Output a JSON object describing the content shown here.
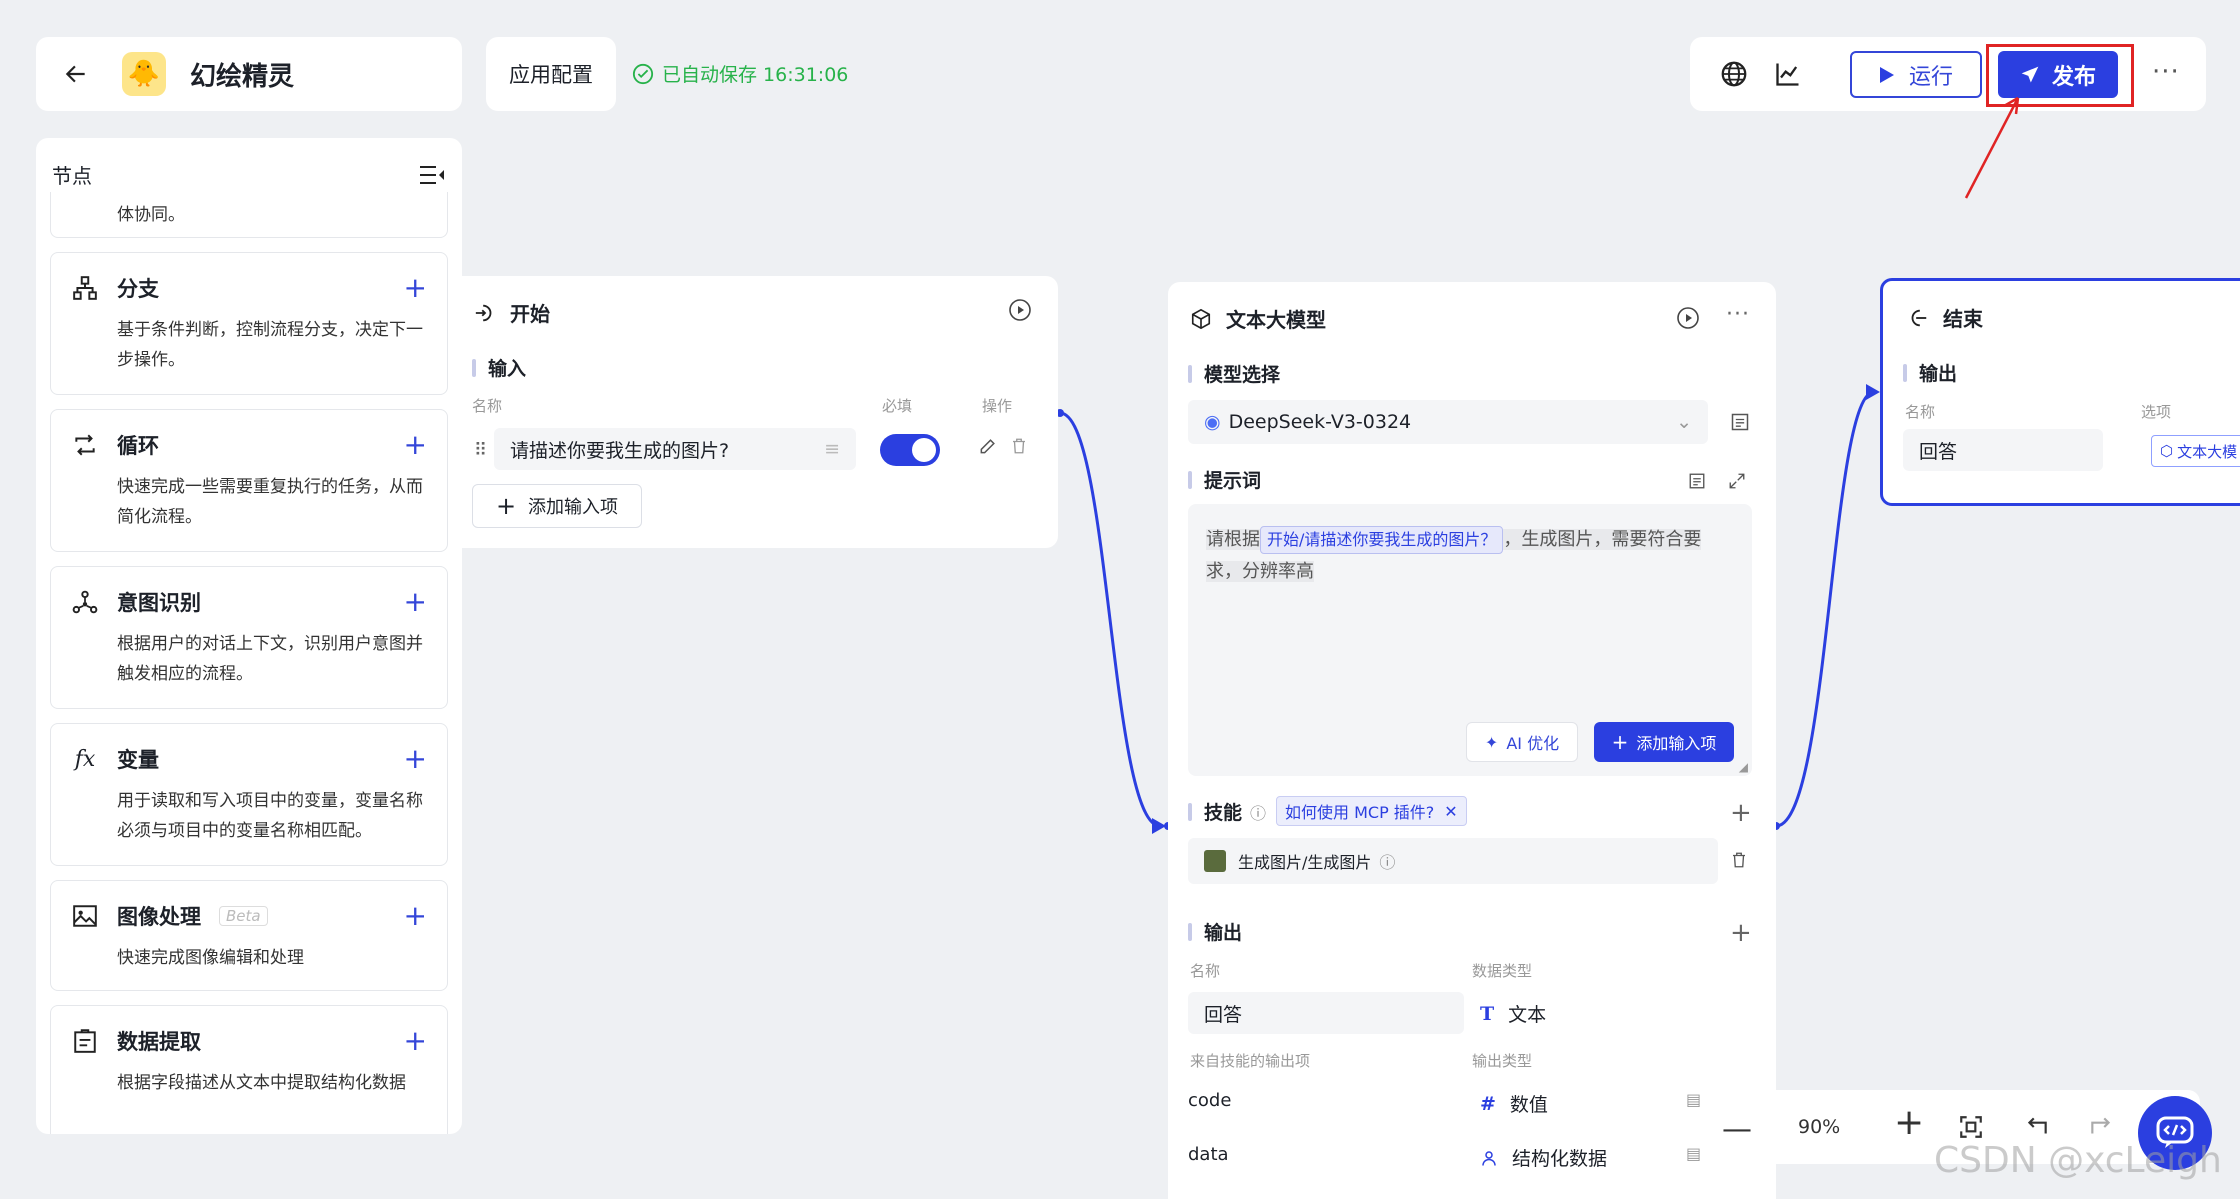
{
  "header": {
    "app_name": "幻绘精灵",
    "app_logo_icon": "duck-emoji-icon",
    "config_tab": "应用配置",
    "autosave_text": "已自动保存 16:31:06",
    "run_label": "运行",
    "publish_label": "发布",
    "more_label": "···"
  },
  "sidebar": {
    "title": "节点",
    "partial_desc": "体协同。",
    "items": [
      {
        "name": "分支",
        "icon": "branch-icon",
        "desc": "基于条件判断，控制流程分支，决定下一步操作。"
      },
      {
        "name": "循环",
        "icon": "loop-icon",
        "desc": "快速完成一些需要重复执行的任务，从而简化流程。"
      },
      {
        "name": "意图识别",
        "icon": "intent-icon",
        "desc": "根据用户的对话上下文，识别用户意图并触发相应的流程。"
      },
      {
        "name": "变量",
        "icon": "fx-icon",
        "desc": "用于读取和写入项目中的变量，变量名称必须与项目中的变量名称相匹配。"
      },
      {
        "name": "图像处理",
        "icon": "image-icon",
        "badge": "Beta",
        "desc": "快速完成图像编辑和处理"
      },
      {
        "name": "数据提取",
        "icon": "extract-icon",
        "desc": "根据字段描述从文本中提取结构化数据"
      }
    ]
  },
  "start_node": {
    "title": "开始",
    "section": "输入",
    "col_name": "名称",
    "col_required": "必填",
    "col_action": "操作",
    "input_value": "请描述你要我生成的图片?",
    "add_input": "添加输入项",
    "required": true
  },
  "llm_node": {
    "title": "文本大模型",
    "model_section": "模型选择",
    "model_name": "DeepSeek-V3-0324",
    "prompt_section": "提示词",
    "prompt_prefix": "请根据",
    "prompt_chip": "开始/请描述你要我生成的图片？",
    "prompt_suffix": "，生成图片，需要符合要求，分辨率高",
    "ai_optimize": "AI 优化",
    "add_input": "添加输入项",
    "skills_section": "技能",
    "skill_chip": "如何使用 MCP 插件?",
    "skill_item": "生成图片/生成图片",
    "output_section": "输出",
    "col_name": "名称",
    "col_type": "数据类型",
    "output_name": "回答",
    "output_type": "文本",
    "skill_outputs_label": "来自技能的输出项",
    "skill_outputs_type_label": "输出类型",
    "skill_outputs": [
      {
        "name": "code",
        "type": "数值",
        "icon": "#"
      },
      {
        "name": "data",
        "type": "结构化数据",
        "icon": "person-icon"
      }
    ]
  },
  "end_node": {
    "title": "结束",
    "section": "输出",
    "col_name": "名称",
    "col_option": "选项",
    "output_name": "回答",
    "option_chip": "文本大模"
  },
  "zoom": {
    "level": "90%"
  },
  "watermark": "CSDN @xcLeigh",
  "colors": {
    "accent": "#2b3fe0",
    "success": "#27b24a",
    "annotation": "#e02424",
    "background": "#eef0f3"
  }
}
